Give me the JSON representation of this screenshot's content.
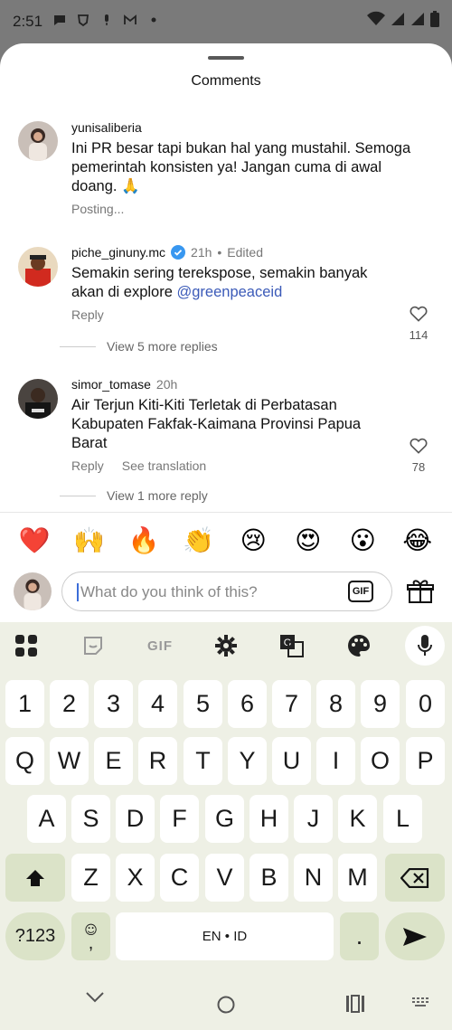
{
  "status_bar": {
    "time": "2:51"
  },
  "sheet": {
    "title": "Comments"
  },
  "comments": [
    {
      "username": "yunisaliberia",
      "text": "Ini PR besar tapi bukan hal yang mustahil. Semoga pemerintah konsisten ya! Jangan cuma di awal doang. 🙏",
      "status": "Posting..."
    },
    {
      "username": "piche_ginuny.mc",
      "verified": true,
      "time": "21h",
      "edited": "Edited",
      "text_before": "Semakin sering terekspose, semakin banyak akan di explore ",
      "mention": "@greenpeaceid",
      "reply": "Reply",
      "likes": "114",
      "more_replies": "View 5 more replies"
    },
    {
      "username": "simor_tomase",
      "time": "20h",
      "text": "Air Terjun Kiti-Kiti Terletak di Perbatasan Kabupaten Fakfak-Kaimana Provinsi Papua Barat",
      "reply": "Reply",
      "see_translation": "See translation",
      "likes": "78",
      "more_replies": "View 1 more reply"
    }
  ],
  "emojis": [
    "❤️",
    "🙌",
    "🔥",
    "👏",
    "😢",
    "😍",
    "😮",
    "😂"
  ],
  "composer": {
    "placeholder": "What do you think of this?",
    "gif_label": "GIF"
  },
  "keyboard": {
    "toolbar_gif": "GIF",
    "row_numbers": [
      "1",
      "2",
      "3",
      "4",
      "5",
      "6",
      "7",
      "8",
      "9",
      "0"
    ],
    "row_1": [
      "Q",
      "W",
      "E",
      "R",
      "T",
      "Y",
      "U",
      "I",
      "O",
      "P"
    ],
    "row_2": [
      "A",
      "S",
      "D",
      "F",
      "G",
      "H",
      "J",
      "K",
      "L"
    ],
    "row_3": [
      "Z",
      "X",
      "C",
      "V",
      "B",
      "N",
      "M"
    ],
    "symbols_key": "?123",
    "comma_key": ",",
    "space_label": "EN • ID",
    "period_key": "."
  },
  "colors": {
    "mention": "#3b5ab8",
    "verified": "#3897f0",
    "keyboard_bg": "#eef0e5",
    "mod_key": "#dbe3c8"
  }
}
